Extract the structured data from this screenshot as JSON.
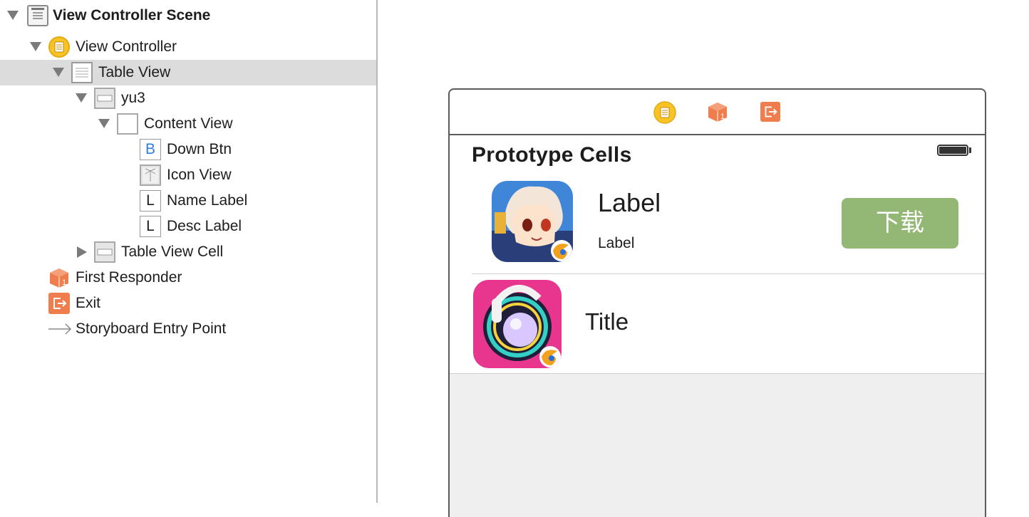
{
  "outline": {
    "items": [
      {
        "label": "View Controller Scene"
      },
      {
        "label": "View Controller"
      },
      {
        "label": "Table View"
      },
      {
        "label": "yu3"
      },
      {
        "label": "Content View"
      },
      {
        "label": "Down Btn",
        "icon_letter": "B"
      },
      {
        "label": "Icon View"
      },
      {
        "label": "Name Label",
        "icon_letter": "L"
      },
      {
        "label": "Desc Label",
        "icon_letter": "L"
      },
      {
        "label": "Table View Cell"
      },
      {
        "label": "First Responder",
        "icon_badge": "1"
      },
      {
        "label": "Exit"
      },
      {
        "label": "Storyboard Entry Point"
      }
    ],
    "selected": "Table View"
  },
  "canvas": {
    "dock_icons": [
      "view-controller-icon",
      "first-responder-icon",
      "exit-icon"
    ],
    "dock_badge": "1",
    "section_title": "Prototype Cells",
    "cell1": {
      "name_label": "Label",
      "desc_label": "Label",
      "button_label": "下载"
    },
    "cell2": {
      "title": "Title"
    }
  },
  "colors": {
    "selection_bg": "#dcdcdc",
    "download_button": "#93b775",
    "view_controller_yellow": "#f7c325",
    "responder_orange": "#ef7d4d"
  }
}
